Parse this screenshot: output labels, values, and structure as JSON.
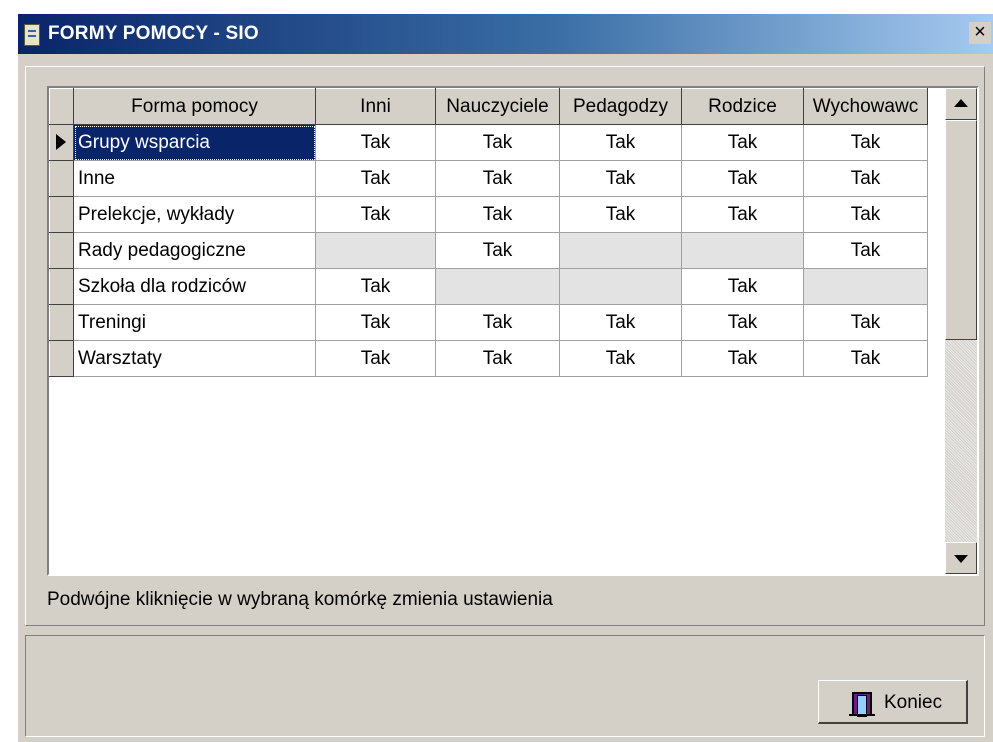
{
  "window": {
    "title": "FORMY POMOCY - SIO",
    "close_label": "×"
  },
  "grid": {
    "columns": [
      "Forma pomocy",
      "Inni",
      "Nauczyciele",
      "Pedagodzy",
      "Rodzice",
      "Wychowawc"
    ],
    "selected_row": 0,
    "rows": [
      {
        "name": "Grupy wsparcia",
        "cells": [
          "Tak",
          "Tak",
          "Tak",
          "Tak",
          "Tak"
        ]
      },
      {
        "name": "Inne",
        "cells": [
          "Tak",
          "Tak",
          "Tak",
          "Tak",
          "Tak"
        ]
      },
      {
        "name": "Prelekcje, wykłady",
        "cells": [
          "Tak",
          "Tak",
          "Tak",
          "Tak",
          "Tak"
        ]
      },
      {
        "name": "Rady pedagogiczne",
        "cells": [
          "",
          "Tak",
          "",
          "",
          "Tak"
        ]
      },
      {
        "name": "Szkoła dla rodziców",
        "cells": [
          "Tak",
          "",
          "",
          "Tak",
          ""
        ]
      },
      {
        "name": "Treningi",
        "cells": [
          "Tak",
          "Tak",
          "Tak",
          "Tak",
          "Tak"
        ]
      },
      {
        "name": "Warsztaty",
        "cells": [
          "Tak",
          "Tak",
          "Tak",
          "Tak",
          "Tak"
        ]
      }
    ]
  },
  "hint_text": "Podwójne kliknięcie w wybraną komórkę zmienia ustawienia",
  "buttons": {
    "koniec_label": "Koniec",
    "koniec_icon": "exit-door-icon"
  }
}
